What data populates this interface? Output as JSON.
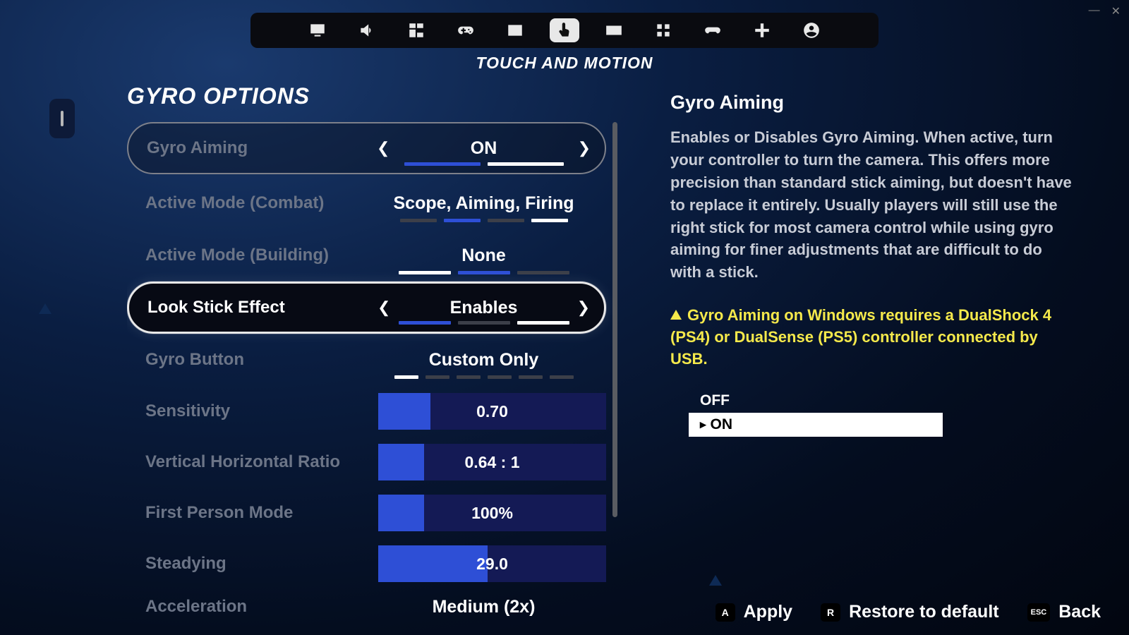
{
  "window": {
    "minimize": "—",
    "close": "✕"
  },
  "tabs": {
    "active_title": "TOUCH AND MOTION",
    "icons": [
      "display",
      "audio",
      "hud",
      "controller",
      "card",
      "touch",
      "keyboard",
      "blocks",
      "gamepad",
      "cross",
      "profile"
    ]
  },
  "section_title": "GYRO OPTIONS",
  "rows": {
    "gyro_aiming": {
      "label": "Gyro Aiming",
      "value": "ON"
    },
    "active_combat": {
      "label": "Active Mode (Combat)",
      "value": "Scope, Aiming, Firing"
    },
    "active_build": {
      "label": "Active Mode (Building)",
      "value": "None"
    },
    "look_stick": {
      "label": "Look Stick Effect",
      "value": "Enables"
    },
    "gyro_button": {
      "label": "Gyro Button",
      "value": "Custom Only"
    },
    "sensitivity": {
      "label": "Sensitivity",
      "value": "0.70",
      "fill_pct": 23
    },
    "vh_ratio": {
      "label": "Vertical Horizontal Ratio",
      "value": "0.64 : 1",
      "fill_pct": 20
    },
    "fp_mode": {
      "label": "First Person Mode",
      "value": "100%",
      "fill_pct": 20
    },
    "steadying": {
      "label": "Steadying",
      "value": "29.0",
      "fill_pct": 48
    },
    "acceleration": {
      "label": "Acceleration",
      "value": "Medium (2x)"
    }
  },
  "help": {
    "title": "Gyro Aiming",
    "body": "Enables or Disables Gyro Aiming. When active, turn your controller to turn the camera. This offers more precision than standard stick aiming, but doesn't have to replace it entirely. Usually players will still use the right stick for most camera control while using gyro aiming for finer adjustments that are difficult to do with a stick.",
    "warning": "Gyro Aiming on Windows requires a DualShock 4 (PS4) or DualSense (PS5) controller connected by USB.",
    "options": {
      "off": "OFF",
      "on": "ON"
    }
  },
  "footer": {
    "apply": {
      "key": "A",
      "label": "Apply"
    },
    "restore": {
      "key": "R",
      "label": "Restore to default"
    },
    "back": {
      "key": "ESC",
      "label": "Back"
    }
  }
}
